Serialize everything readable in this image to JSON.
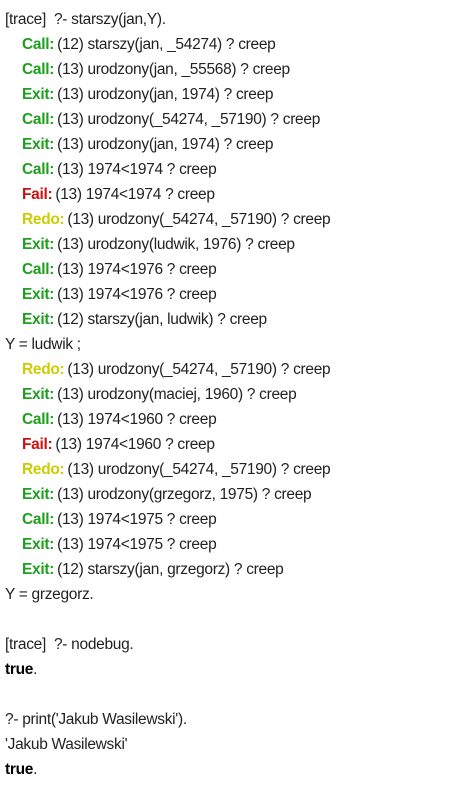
{
  "colors": {
    "call": "#1f9f1f",
    "exit": "#1f9f1f",
    "redo": "#cccc00",
    "fail": "#cc1111",
    "text": "#222222"
  },
  "lines": [
    {
      "type": "plain",
      "text": "[trace]  ?- starszy(jan,Y)."
    },
    {
      "type": "port",
      "port": "call",
      "label": "Call:",
      "text": "(12) starszy(jan, _54274) ? creep"
    },
    {
      "type": "port",
      "port": "call",
      "label": "Call:",
      "text": "(13) urodzony(jan, _55568) ? creep"
    },
    {
      "type": "port",
      "port": "exit",
      "label": "Exit:",
      "text": "(13) urodzony(jan, 1974) ? creep"
    },
    {
      "type": "port",
      "port": "call",
      "label": "Call:",
      "text": "(13) urodzony(_54274, _57190) ? creep"
    },
    {
      "type": "port",
      "port": "exit",
      "label": "Exit:",
      "text": "(13) urodzony(jan, 1974) ? creep"
    },
    {
      "type": "port",
      "port": "call",
      "label": "Call:",
      "text": "(13) 1974<1974 ? creep"
    },
    {
      "type": "port",
      "port": "fail",
      "label": "Fail:",
      "text": "(13) 1974<1974 ? creep"
    },
    {
      "type": "port",
      "port": "redo",
      "label": "Redo:",
      "text": "(13) urodzony(_54274, _57190) ? creep"
    },
    {
      "type": "port",
      "port": "exit",
      "label": "Exit:",
      "text": "(13) urodzony(ludwik, 1976) ? creep"
    },
    {
      "type": "port",
      "port": "call",
      "label": "Call:",
      "text": "(13) 1974<1976 ? creep"
    },
    {
      "type": "port",
      "port": "exit",
      "label": "Exit:",
      "text": "(13) 1974<1976 ? creep"
    },
    {
      "type": "port",
      "port": "exit",
      "label": "Exit:",
      "text": "(12) starszy(jan, ludwik) ? creep"
    },
    {
      "type": "plain",
      "text": "Y = ludwik ;"
    },
    {
      "type": "port",
      "port": "redo",
      "label": "Redo:",
      "text": "(13) urodzony(_54274, _57190) ? creep"
    },
    {
      "type": "port",
      "port": "exit",
      "label": "Exit:",
      "text": "(13) urodzony(maciej, 1960) ? creep"
    },
    {
      "type": "port",
      "port": "call",
      "label": "Call:",
      "text": "(13) 1974<1960 ? creep"
    },
    {
      "type": "port",
      "port": "fail",
      "label": "Fail:",
      "text": "(13) 1974<1960 ? creep"
    },
    {
      "type": "port",
      "port": "redo",
      "label": "Redo:",
      "text": "(13) urodzony(_54274, _57190) ? creep"
    },
    {
      "type": "port",
      "port": "exit",
      "label": "Exit:",
      "text": "(13) urodzony(grzegorz, 1975) ? creep"
    },
    {
      "type": "port",
      "port": "call",
      "label": "Call:",
      "text": "(13) 1974<1975 ? creep"
    },
    {
      "type": "port",
      "port": "exit",
      "label": "Exit:",
      "text": "(13) 1974<1975 ? creep"
    },
    {
      "type": "port",
      "port": "exit",
      "label": "Exit:",
      "text": "(12) starszy(jan, grzegorz) ? creep"
    },
    {
      "type": "plain",
      "text": "Y = grzegorz."
    },
    {
      "type": "blank"
    },
    {
      "type": "plain",
      "text": "[trace]  ?- nodebug."
    },
    {
      "type": "result",
      "bold": "true",
      "rest": "."
    },
    {
      "type": "blank"
    },
    {
      "type": "plain",
      "text": "?- print('Jakub Wasilewski')."
    },
    {
      "type": "plain",
      "text": "'Jakub Wasilewski'"
    },
    {
      "type": "result",
      "bold": "true",
      "rest": "."
    }
  ]
}
